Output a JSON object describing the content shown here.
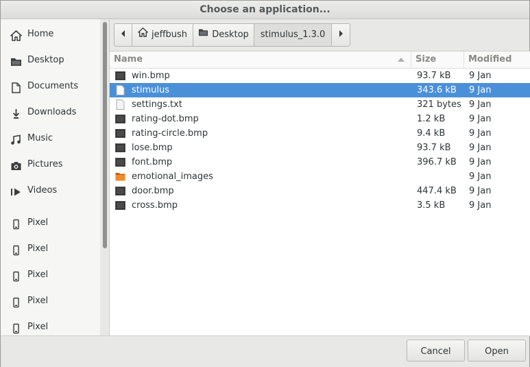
{
  "window": {
    "title": "Choose an application..."
  },
  "sidebar": {
    "items": [
      {
        "label": "Home",
        "icon": "home-icon"
      },
      {
        "label": "Desktop",
        "icon": "folder-icon"
      },
      {
        "label": "Documents",
        "icon": "document-icon"
      },
      {
        "label": "Downloads",
        "icon": "download-icon"
      },
      {
        "label": "Music",
        "icon": "music-icon"
      },
      {
        "label": "Pictures",
        "icon": "camera-icon"
      },
      {
        "label": "Videos",
        "icon": "video-icon"
      },
      {
        "label": "Pixel",
        "icon": "phone-icon"
      },
      {
        "label": "Pixel",
        "icon": "phone-icon"
      },
      {
        "label": "Pixel",
        "icon": "phone-icon"
      },
      {
        "label": "Pixel",
        "icon": "phone-icon"
      },
      {
        "label": "Pixel",
        "icon": "phone-icon"
      }
    ]
  },
  "pathbar": {
    "segments": [
      {
        "label": "jeffbush",
        "icon": "home-icon"
      },
      {
        "label": "Desktop",
        "icon": "folder-icon"
      },
      {
        "label": "stimulus_1.3.0"
      }
    ]
  },
  "filelist": {
    "columns": {
      "name": "Name",
      "size": "Size",
      "modified": "Modified"
    },
    "rows": [
      {
        "name": "win.bmp",
        "size": "93.7 kB",
        "modified": "9 Jan",
        "type": "image"
      },
      {
        "name": "stimulus",
        "size": "343.6 kB",
        "modified": "9 Jan",
        "type": "file",
        "selected": true
      },
      {
        "name": "settings.txt",
        "size": "321 bytes",
        "modified": "9 Jan",
        "type": "file"
      },
      {
        "name": "rating-dot.bmp",
        "size": "1.2 kB",
        "modified": "9 Jan",
        "type": "image"
      },
      {
        "name": "rating-circle.bmp",
        "size": "9.4 kB",
        "modified": "9 Jan",
        "type": "image"
      },
      {
        "name": "lose.bmp",
        "size": "93.7 kB",
        "modified": "9 Jan",
        "type": "image"
      },
      {
        "name": "font.bmp",
        "size": "396.7 kB",
        "modified": "9 Jan",
        "type": "image"
      },
      {
        "name": "emotional_images",
        "size": "",
        "modified": "9 Jan",
        "type": "folder"
      },
      {
        "name": "door.bmp",
        "size": "447.4 kB",
        "modified": "9 Jan",
        "type": "image"
      },
      {
        "name": "cross.bmp",
        "size": "3.5 kB",
        "modified": "9 Jan",
        "type": "image"
      }
    ]
  },
  "footer": {
    "cancel_label": "Cancel",
    "open_label": "Open"
  },
  "colors": {
    "selection": "#4a90d9",
    "folder": "#e8731f"
  }
}
